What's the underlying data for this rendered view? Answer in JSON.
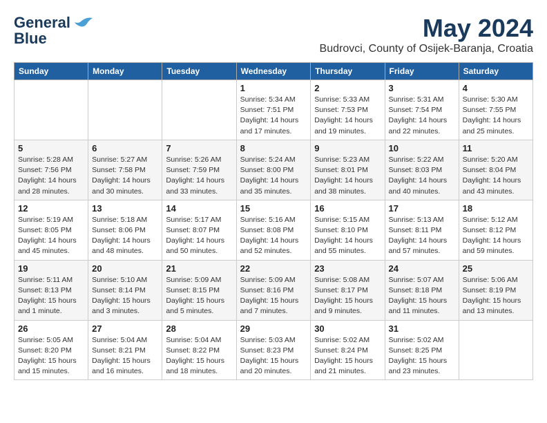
{
  "header": {
    "logo_line1": "General",
    "logo_line2": "Blue",
    "month_year": "May 2024",
    "location": "Budrovci, County of Osijek-Baranja, Croatia"
  },
  "weekdays": [
    "Sunday",
    "Monday",
    "Tuesday",
    "Wednesday",
    "Thursday",
    "Friday",
    "Saturday"
  ],
  "weeks": [
    [
      {
        "day": "",
        "info": ""
      },
      {
        "day": "",
        "info": ""
      },
      {
        "day": "",
        "info": ""
      },
      {
        "day": "1",
        "info": "Sunrise: 5:34 AM\nSunset: 7:51 PM\nDaylight: 14 hours and 17 minutes."
      },
      {
        "day": "2",
        "info": "Sunrise: 5:33 AM\nSunset: 7:53 PM\nDaylight: 14 hours and 19 minutes."
      },
      {
        "day": "3",
        "info": "Sunrise: 5:31 AM\nSunset: 7:54 PM\nDaylight: 14 hours and 22 minutes."
      },
      {
        "day": "4",
        "info": "Sunrise: 5:30 AM\nSunset: 7:55 PM\nDaylight: 14 hours and 25 minutes."
      }
    ],
    [
      {
        "day": "5",
        "info": "Sunrise: 5:28 AM\nSunset: 7:56 PM\nDaylight: 14 hours and 28 minutes."
      },
      {
        "day": "6",
        "info": "Sunrise: 5:27 AM\nSunset: 7:58 PM\nDaylight: 14 hours and 30 minutes."
      },
      {
        "day": "7",
        "info": "Sunrise: 5:26 AM\nSunset: 7:59 PM\nDaylight: 14 hours and 33 minutes."
      },
      {
        "day": "8",
        "info": "Sunrise: 5:24 AM\nSunset: 8:00 PM\nDaylight: 14 hours and 35 minutes."
      },
      {
        "day": "9",
        "info": "Sunrise: 5:23 AM\nSunset: 8:01 PM\nDaylight: 14 hours and 38 minutes."
      },
      {
        "day": "10",
        "info": "Sunrise: 5:22 AM\nSunset: 8:03 PM\nDaylight: 14 hours and 40 minutes."
      },
      {
        "day": "11",
        "info": "Sunrise: 5:20 AM\nSunset: 8:04 PM\nDaylight: 14 hours and 43 minutes."
      }
    ],
    [
      {
        "day": "12",
        "info": "Sunrise: 5:19 AM\nSunset: 8:05 PM\nDaylight: 14 hours and 45 minutes."
      },
      {
        "day": "13",
        "info": "Sunrise: 5:18 AM\nSunset: 8:06 PM\nDaylight: 14 hours and 48 minutes."
      },
      {
        "day": "14",
        "info": "Sunrise: 5:17 AM\nSunset: 8:07 PM\nDaylight: 14 hours and 50 minutes."
      },
      {
        "day": "15",
        "info": "Sunrise: 5:16 AM\nSunset: 8:08 PM\nDaylight: 14 hours and 52 minutes."
      },
      {
        "day": "16",
        "info": "Sunrise: 5:15 AM\nSunset: 8:10 PM\nDaylight: 14 hours and 55 minutes."
      },
      {
        "day": "17",
        "info": "Sunrise: 5:13 AM\nSunset: 8:11 PM\nDaylight: 14 hours and 57 minutes."
      },
      {
        "day": "18",
        "info": "Sunrise: 5:12 AM\nSunset: 8:12 PM\nDaylight: 14 hours and 59 minutes."
      }
    ],
    [
      {
        "day": "19",
        "info": "Sunrise: 5:11 AM\nSunset: 8:13 PM\nDaylight: 15 hours and 1 minute."
      },
      {
        "day": "20",
        "info": "Sunrise: 5:10 AM\nSunset: 8:14 PM\nDaylight: 15 hours and 3 minutes."
      },
      {
        "day": "21",
        "info": "Sunrise: 5:09 AM\nSunset: 8:15 PM\nDaylight: 15 hours and 5 minutes."
      },
      {
        "day": "22",
        "info": "Sunrise: 5:09 AM\nSunset: 8:16 PM\nDaylight: 15 hours and 7 minutes."
      },
      {
        "day": "23",
        "info": "Sunrise: 5:08 AM\nSunset: 8:17 PM\nDaylight: 15 hours and 9 minutes."
      },
      {
        "day": "24",
        "info": "Sunrise: 5:07 AM\nSunset: 8:18 PM\nDaylight: 15 hours and 11 minutes."
      },
      {
        "day": "25",
        "info": "Sunrise: 5:06 AM\nSunset: 8:19 PM\nDaylight: 15 hours and 13 minutes."
      }
    ],
    [
      {
        "day": "26",
        "info": "Sunrise: 5:05 AM\nSunset: 8:20 PM\nDaylight: 15 hours and 15 minutes."
      },
      {
        "day": "27",
        "info": "Sunrise: 5:04 AM\nSunset: 8:21 PM\nDaylight: 15 hours and 16 minutes."
      },
      {
        "day": "28",
        "info": "Sunrise: 5:04 AM\nSunset: 8:22 PM\nDaylight: 15 hours and 18 minutes."
      },
      {
        "day": "29",
        "info": "Sunrise: 5:03 AM\nSunset: 8:23 PM\nDaylight: 15 hours and 20 minutes."
      },
      {
        "day": "30",
        "info": "Sunrise: 5:02 AM\nSunset: 8:24 PM\nDaylight: 15 hours and 21 minutes."
      },
      {
        "day": "31",
        "info": "Sunrise: 5:02 AM\nSunset: 8:25 PM\nDaylight: 15 hours and 23 minutes."
      },
      {
        "day": "",
        "info": ""
      }
    ]
  ]
}
